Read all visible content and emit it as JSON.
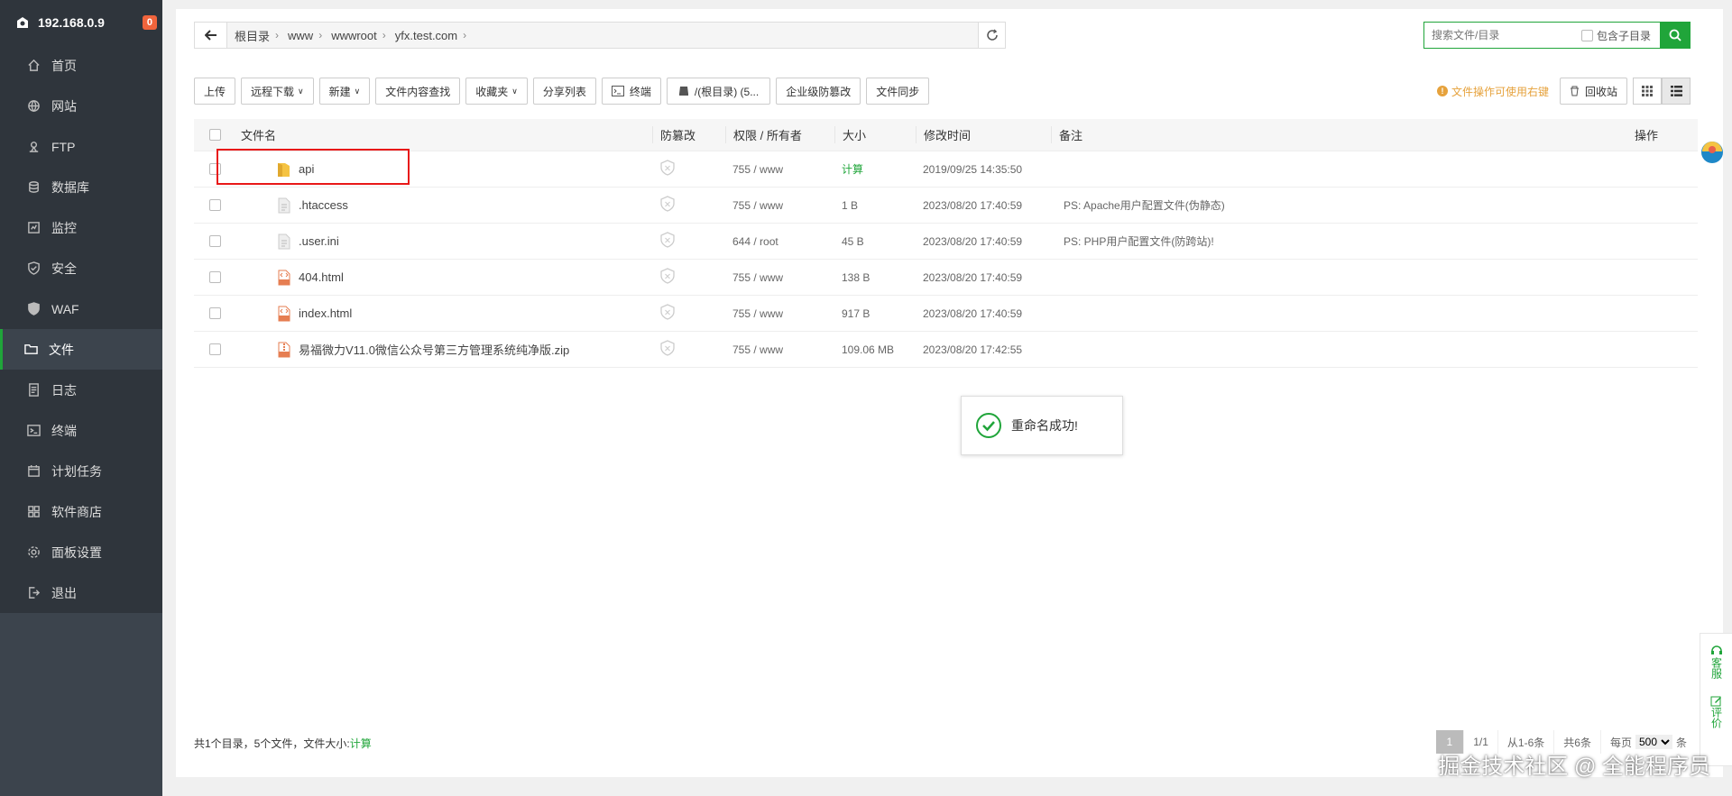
{
  "sidebar": {
    "host": "192.168.0.9",
    "badge": "0",
    "items": [
      {
        "label": "首页",
        "icon": "home-icon"
      },
      {
        "label": "网站",
        "icon": "globe-icon"
      },
      {
        "label": "FTP",
        "icon": "ftp-icon"
      },
      {
        "label": "数据库",
        "icon": "database-icon"
      },
      {
        "label": "监控",
        "icon": "monitor-icon"
      },
      {
        "label": "安全",
        "icon": "shield-icon"
      },
      {
        "label": "WAF",
        "icon": "waf-shield-icon"
      },
      {
        "label": "文件",
        "icon": "folder-icon"
      },
      {
        "label": "日志",
        "icon": "log-icon"
      },
      {
        "label": "终端",
        "icon": "terminal-icon"
      },
      {
        "label": "计划任务",
        "icon": "calendar-icon"
      },
      {
        "label": "软件商店",
        "icon": "apps-icon"
      },
      {
        "label": "面板设置",
        "icon": "gear-icon"
      },
      {
        "label": "退出",
        "icon": "logout-icon"
      }
    ],
    "active": "文件"
  },
  "path": {
    "crumbs": [
      "根目录",
      "www",
      "wwwroot",
      "yfx.test.com"
    ]
  },
  "search": {
    "placeholder": "搜索文件/目录",
    "subdir_label": "包含子目录"
  },
  "toolbar": {
    "upload": "上传",
    "remote_download": "远程下载",
    "new": "新建",
    "content_search": "文件内容查找",
    "favorites": "收藏夹",
    "share_list": "分享列表",
    "terminal": "终端",
    "disk": "/(根目录) (5...",
    "tamper": "企业级防篡改",
    "sync": "文件同步",
    "tip": "文件操作可使用右键",
    "recycle": "回收站"
  },
  "table": {
    "headers": {
      "name": "文件名",
      "protect": "防篡改",
      "perm": "权限 / 所有者",
      "size": "大小",
      "mtime": "修改时间",
      "note": "备注",
      "op": "操作"
    },
    "rows": [
      {
        "name": "api",
        "type": "folder",
        "perm": "755 / www",
        "size": "计算",
        "mtime": "2019/09/25 14:35:50",
        "note": ""
      },
      {
        "name": ".htaccess",
        "type": "file",
        "perm": "755 / www",
        "size": "1 B",
        "mtime": "2023/08/20 17:40:59",
        "note": "PS: Apache用户配置文件(伪静态)"
      },
      {
        "name": ".user.ini",
        "type": "file",
        "perm": "644 / root",
        "size": "45 B",
        "mtime": "2023/08/20 17:40:59",
        "note": "PS: PHP用户配置文件(防跨站)!"
      },
      {
        "name": "404.html",
        "type": "html",
        "perm": "755 / www",
        "size": "138 B",
        "mtime": "2023/08/20 17:40:59",
        "note": ""
      },
      {
        "name": "index.html",
        "type": "html",
        "perm": "755 / www",
        "size": "917 B",
        "mtime": "2023/08/20 17:40:59",
        "note": ""
      },
      {
        "name": "易福微力V11.0微信公众号第三方管理系统纯净版.zip",
        "type": "zip",
        "perm": "755 / www",
        "size": "109.06 MB",
        "mtime": "2023/08/20 17:42:55",
        "note": ""
      }
    ]
  },
  "toast": {
    "message": "重命名成功!"
  },
  "footer": {
    "summary": "共1个目录，5个文件，文件大小:",
    "calc": "计算",
    "page_current": "1",
    "page_total": "1/1",
    "range": "从1-6条",
    "count": "共6条",
    "per_page_label": "每页",
    "per_page": "500",
    "per_page_unit": "条"
  },
  "float": {
    "service": "客服",
    "review": "评价"
  },
  "watermark": "掘金技术社区 @ 全能程序员",
  "colors": {
    "accent": "#20a53a",
    "sidebar": "#3c444d",
    "highlight": "#e81818",
    "tip": "#e6a23c"
  }
}
